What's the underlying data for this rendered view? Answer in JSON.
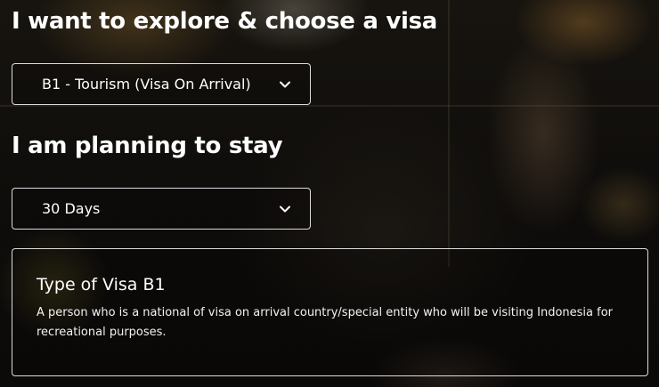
{
  "visa_section": {
    "heading": "I want to explore & choose a visa",
    "selected_visa": "B1 - Tourism (Visa On Arrival)",
    "dropdown_icon": "chevron-down-icon"
  },
  "stay_section": {
    "heading": "I am planning to stay",
    "selected_duration": "30 Days",
    "dropdown_icon": "chevron-down-icon"
  },
  "visa_info": {
    "title": "Type of Visa B1",
    "description": "A person who is a national of visa on arrival country/special entity who will be visiting Indonesia for recreational purposes."
  },
  "colors": {
    "text": "#ffffff",
    "border": "#ffffff",
    "background": "#0e0c0a"
  }
}
